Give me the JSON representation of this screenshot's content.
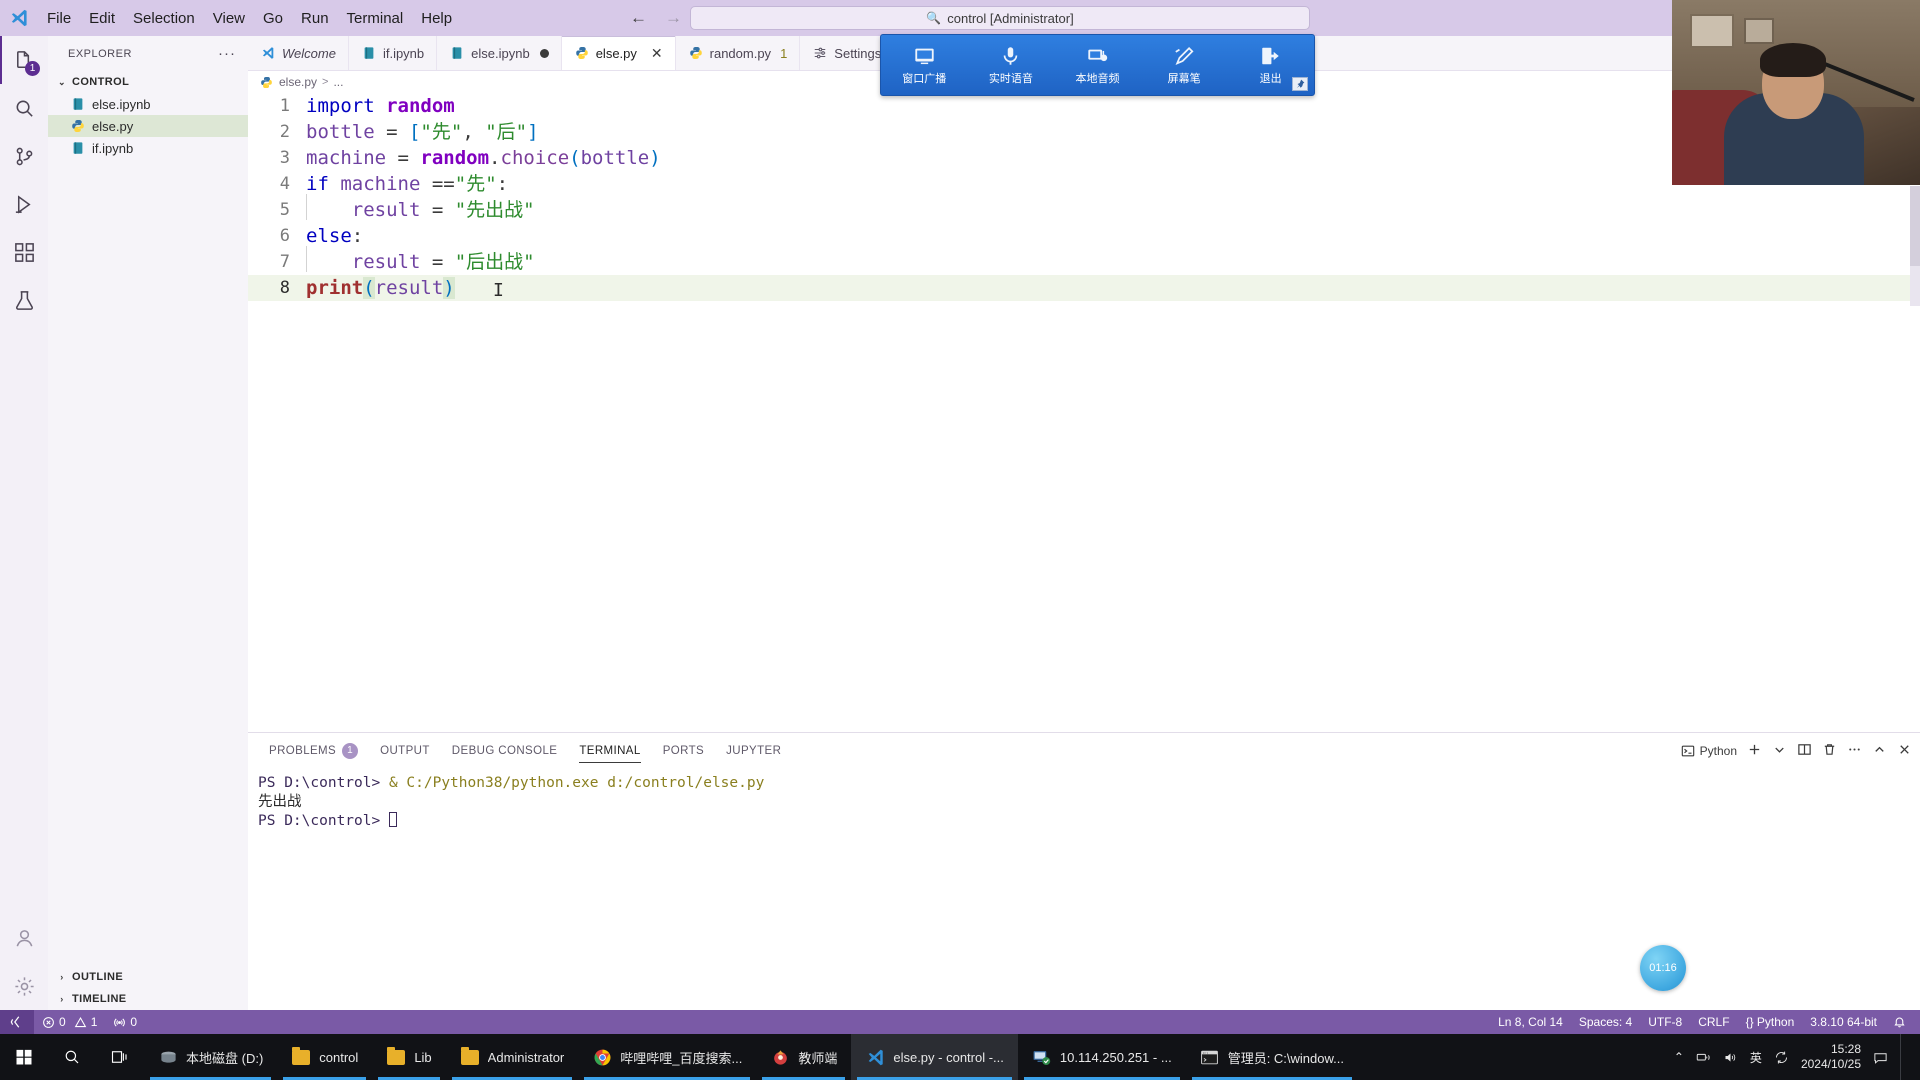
{
  "titlebar": {
    "menus": [
      "File",
      "Edit",
      "Selection",
      "View",
      "Go",
      "Run",
      "Terminal",
      "Help"
    ],
    "back_arrow": "←",
    "forward_arrow": "→",
    "command_center_text": "control [Administrator]",
    "search_icon": "search-icon"
  },
  "activitybar": {
    "items": [
      {
        "name": "explorer",
        "badge": "1"
      },
      {
        "name": "search",
        "badge": ""
      },
      {
        "name": "source-control",
        "badge": ""
      },
      {
        "name": "run-and-debug",
        "badge": ""
      },
      {
        "name": "extensions",
        "badge": ""
      },
      {
        "name": "testing",
        "badge": ""
      }
    ],
    "bottom": [
      {
        "name": "accounts"
      },
      {
        "name": "manage-settings"
      }
    ]
  },
  "sidebar": {
    "title": "EXPLORER",
    "more_actions": "···",
    "section": {
      "label": "CONTROL",
      "chevron": "⌄"
    },
    "files": [
      {
        "name": "else.ipynb",
        "icon": "notebook-icon",
        "selected": false
      },
      {
        "name": "else.py",
        "icon": "python-icon",
        "selected": true
      },
      {
        "name": "if.ipynb",
        "icon": "notebook-icon",
        "selected": false
      }
    ],
    "bottom_sections": [
      {
        "label": "OUTLINE",
        "chevron": "›"
      },
      {
        "label": "TIMELINE",
        "chevron": "›"
      }
    ]
  },
  "tabs": [
    {
      "label": "Welcome",
      "icon": "vscode-icon",
      "italic": true,
      "active": false,
      "dirty": false,
      "close": false,
      "count": ""
    },
    {
      "label": "if.ipynb",
      "icon": "notebook-icon",
      "italic": false,
      "active": false,
      "dirty": false,
      "close": false,
      "count": ""
    },
    {
      "label": "else.ipynb",
      "icon": "notebook-icon",
      "italic": false,
      "active": false,
      "dirty": true,
      "close": false,
      "count": ""
    },
    {
      "label": "else.py",
      "icon": "python-icon",
      "italic": false,
      "active": true,
      "dirty": false,
      "close": true,
      "count": ""
    },
    {
      "label": "random.py",
      "icon": "python-icon",
      "italic": false,
      "active": false,
      "dirty": false,
      "close": false,
      "count": "1"
    },
    {
      "label": "Settings",
      "icon": "settings-icon",
      "italic": false,
      "active": false,
      "dirty": false,
      "close": false,
      "count": ""
    }
  ],
  "breadcrumbs": {
    "file": "else.py",
    "separator": ">",
    "trailing": "..."
  },
  "editor": {
    "lines": [
      {
        "no": "1",
        "text": "import random"
      },
      {
        "no": "2",
        "text": "bottle = [\"先\", \"后\"]"
      },
      {
        "no": "3",
        "text": "machine = random.choice(bottle)"
      },
      {
        "no": "4",
        "text": "if machine ==\"先\":"
      },
      {
        "no": "5",
        "text": "    result = \"先出战\""
      },
      {
        "no": "6",
        "text": "else:"
      },
      {
        "no": "7",
        "text": "    result = \"后出战\""
      },
      {
        "no": "8",
        "text": "print(result)"
      }
    ],
    "current_line": 8,
    "cursor_glyph": "I"
  },
  "panel": {
    "tabs": [
      {
        "label": "PROBLEMS",
        "badge": "1",
        "active": false
      },
      {
        "label": "OUTPUT",
        "badge": "",
        "active": false
      },
      {
        "label": "DEBUG CONSOLE",
        "badge": "",
        "active": false
      },
      {
        "label": "TERMINAL",
        "badge": "",
        "active": true
      },
      {
        "label": "PORTS",
        "badge": "",
        "active": false
      },
      {
        "label": "JUPYTER",
        "badge": "",
        "active": false
      }
    ],
    "shell_label": "Python",
    "actions": [
      "new-terminal-icon",
      "chevron-down-icon",
      "split-terminal-icon",
      "kill-terminal-icon",
      "more-actions-icon",
      "maximize-panel-icon",
      "close-panel-icon"
    ],
    "terminal": [
      {
        "prompt": "PS D:\\control> ",
        "command": "& C:/Python38/python.exe d:/control/else.py",
        "type": "command"
      },
      {
        "prompt": "",
        "command": "先出战",
        "type": "output"
      },
      {
        "prompt": "PS D:\\control> ",
        "command": "",
        "type": "prompt"
      }
    ]
  },
  "statusbar": {
    "remote_icon": "remote-window-icon",
    "errors": "0",
    "warnings": "1",
    "ports": "0",
    "right_items": [
      "Ln 8, Col 14",
      "Spaces: 4",
      "UTF-8",
      "CRLF",
      "{} Python",
      "3.8.10 64-bit"
    ],
    "bell_icon": "bell-icon"
  },
  "floating_toolbar": {
    "items": [
      {
        "label": "窗口广播",
        "icon": "broadcast-window-icon"
      },
      {
        "label": "实时语音",
        "icon": "microphone-icon"
      },
      {
        "label": "本地音频",
        "icon": "speaker-icon"
      },
      {
        "label": "屏幕笔",
        "icon": "pen-icon"
      },
      {
        "label": "退出",
        "icon": "exit-icon"
      }
    ],
    "pin_icon": "pin-icon"
  },
  "timer": {
    "value": "01:16"
  },
  "taskbar": {
    "start_icon": "windows-start-icon",
    "search_icon": "search-icon",
    "taskview_icon": "task-view-icon",
    "apps": [
      {
        "label": "本地磁盘 (D:)",
        "icon": "disk-icon",
        "running": true,
        "focused": false
      },
      {
        "label": "control",
        "icon": "folder-icon",
        "running": true,
        "focused": false
      },
      {
        "label": "Lib",
        "icon": "folder-icon",
        "running": true,
        "focused": false
      },
      {
        "label": "Administrator",
        "icon": "folder-icon",
        "running": true,
        "focused": false
      },
      {
        "label": "哔哩哔哩_百度搜索...",
        "icon": "chrome-icon",
        "running": true,
        "focused": false
      },
      {
        "label": "教师端",
        "icon": "teacher-app-icon",
        "running": true,
        "focused": false
      },
      {
        "label": "else.py - control -...",
        "icon": "vscode-icon",
        "running": true,
        "focused": true
      },
      {
        "label": "10.114.250.251 - ...",
        "icon": "remote-desktop-icon",
        "running": true,
        "focused": false
      },
      {
        "label": "管理员: C:\\window...",
        "icon": "console-icon",
        "running": true,
        "focused": false
      }
    ],
    "tray": {
      "chevron": "⌃",
      "icons": [
        "network-icon",
        "volume-icon",
        "ime-icon",
        "sync-icon"
      ],
      "ime_label": "英",
      "time": "15:28",
      "date": "2024/10/25",
      "notification_icon": "notification-icon"
    }
  }
}
